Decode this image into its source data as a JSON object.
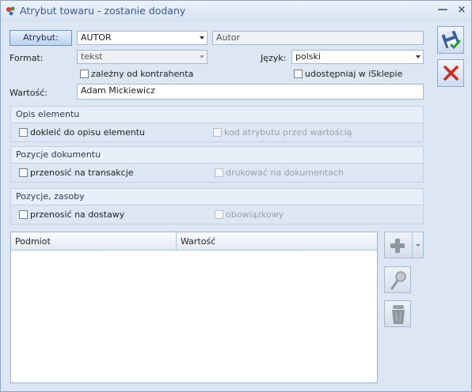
{
  "window": {
    "title": "Atrybut towaru - zostanie dodany",
    "minimize_glyph": "—",
    "close_glyph": "×"
  },
  "form": {
    "attribute_button": "Atrybut:",
    "attribute_code": "AUTOR",
    "attribute_name": "Autor",
    "format_label": "Format:",
    "format_value": "tekst",
    "language_label": "Język:",
    "language_value": "polski",
    "dependent_contractor": "zależny od kontrahenta",
    "share_eshop": "udostępniaj w iSklepie",
    "value_label": "Wartość:",
    "value": "Adam Mickiewicz"
  },
  "groups": {
    "opis": {
      "title": "Opis elementu",
      "append": "dokleić do opisu elementu",
      "code_before": "kod atrybutu przed wartością"
    },
    "pozycje_dok": {
      "title": "Pozycje dokumentu",
      "transfer": "przenosić na transakcje",
      "print": "drukować na dokumentach"
    },
    "pozycje_zasoby": {
      "title": "Pozycje, zasoby",
      "transfer": "przenosić na dostawy",
      "required": "obowiązkowy"
    }
  },
  "table": {
    "columns": [
      "Podmiot",
      "Wartość"
    ],
    "rows": []
  },
  "icons": {
    "app": "colored-dots-icon",
    "save": "floppy-disk-save-icon",
    "cancel": "red-x-cancel-icon",
    "add": "plus-icon",
    "edit": "magnifier-icon",
    "delete": "trash-bin-icon"
  }
}
